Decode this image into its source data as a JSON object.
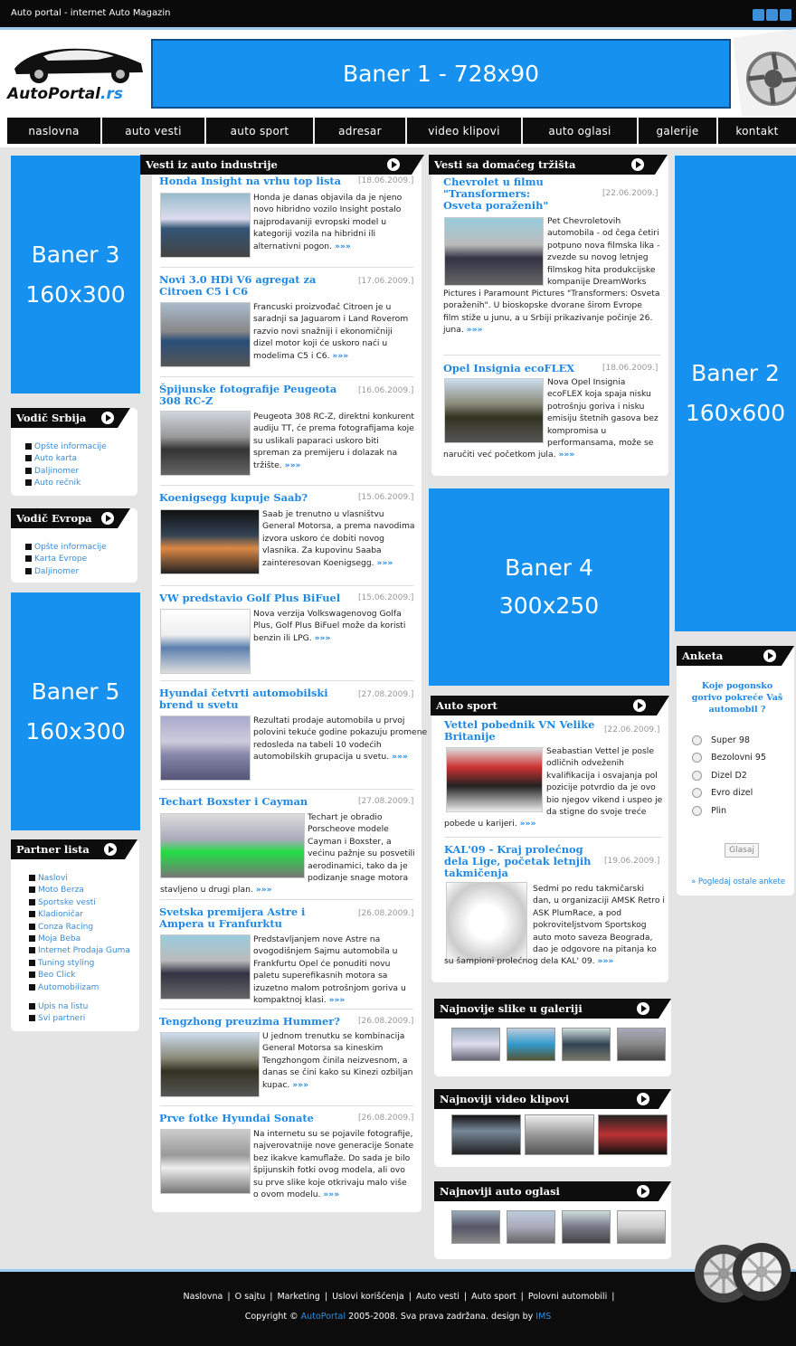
{
  "site": {
    "title": "Auto portal - internet Auto Magazin",
    "logo_main": "AutoPortal",
    "logo_tld": ".rs"
  },
  "banners": {
    "b1": "Baner 1 - 728x90",
    "b2_line1": "Baner 2",
    "b2_line2": "160x600",
    "b3_line1": "Baner 3",
    "b3_line2": "160x300",
    "b4_line1": "Baner 4",
    "b4_line2": "300x250",
    "b5_line1": "Baner 5",
    "b5_line2": "160x300"
  },
  "nav": [
    "naslovna",
    "auto vesti",
    "auto sport",
    "adresar",
    "video klipovi",
    "auto oglasi",
    "galerije",
    "kontakt"
  ],
  "vodic_srbija": {
    "title": "Vodič Srbija",
    "items": [
      "Opšte informacije",
      "Auto karta",
      "Daljinomer",
      "Auto rečnik"
    ]
  },
  "vodic_evropa": {
    "title": "Vodič Evropa",
    "items": [
      "Opšte informacije",
      "Karta Evrope",
      "Daljinomer"
    ]
  },
  "partner_lista": {
    "title": "Partner lista",
    "items": [
      "Naslovi",
      "Moto Berza",
      "Sportske vesti",
      "Kladioničar",
      "Conza Racing",
      "Moja Beba",
      "Internet Prodaja Guma",
      "Tuning styling",
      "Beo Click",
      "Automobilizam"
    ],
    "extra": [
      "Upis na listu",
      "Svi partneri"
    ]
  },
  "industry": {
    "title": "Vesti iz auto industrije",
    "articles": [
      {
        "title": "Honda Insight na vrhu top lista",
        "date": "[18.06.2009.]",
        "text": "Honda je danas objavila da je njeno novo hibridno vozilo Insight postalo najprodavaniji evropski model u kategoriji vozila na hibridni ili alternativni pogon."
      },
      {
        "title": "Novi 3.0 HDi V6 agregat za Citroen C5 i C6",
        "date": "[17.06.2009.]",
        "text": "Francuski proizvođač Citroen je u saradnji sa Jaguarom i Land Roverom razvio novi snažniji i ekonomičniji dizel motor koji će uskoro naći u modelima C5 i C6."
      },
      {
        "title": "Špijunske fotografije Peugeota 308 RC-Z",
        "date": "[16.06.2009.]",
        "text": "Peugeota 308 RC-Z, direktni konkurent audiju TT, će prema fotografijama koje su uslikali paparaci uskoro biti spreman za premijeru i dolazak na tržište."
      },
      {
        "title": "Koenigsegg kupuje Saab?",
        "date": "[15.06.2009.]",
        "text": "Saab je trenutno u vlasništvu General Motorsa, a prema navodima izvora uskoro će dobiti novog vlasnika. Za kupovinu Saaba zainteresovan Koenigsegg."
      },
      {
        "title": "VW predstavio Golf Plus BiFuel",
        "date": "[15.06.2009.]",
        "text": "Nova verzija Volkswagenovog Golfa Plus, Golf Plus BiFuel može da koristi benzin ili LPG."
      },
      {
        "title": "Hyundai četvrti automobilski brend u svetu",
        "date": "[27.08.2009.]",
        "text": "Rezultati prodaje automobila u prvoj polovini tekuće godine pokazuju promene redosleda na tabeli 10 vodećih automobilskih grupacija u svetu."
      },
      {
        "title": "Techart Boxster i Cayman",
        "date": "[27.08.2009.]",
        "text_a": "Techart je obradio Porscheove modele Cayman i Boxster, a većinu pažnje su posvetili aerodinamici, tako da je podizanje snage motora",
        "text_b": "stavljeno u drugi plan."
      },
      {
        "title": "Svetska premijera Astre i Ampera u Franfurktu",
        "date": "[26.08.2009.]",
        "text": "Predstavljanjem nove Astre na ovogodišnjem Sajmu automobila u Frankfurtu Opel će ponuditi novu paletu superefikasnih motora sa izuzetno malom potrošnjom goriva u kompaktnoj klasi."
      },
      {
        "title": "Tengzhong preuzima Hummer?",
        "date": "[26.08.2009.]",
        "text": "U jednom trenutku se kombinacija General Motorsa sa kineskim Tengzhongom činila neizvesnom, a danas se čini kako su Kinezi ozbiljan kupac."
      },
      {
        "title": "Prve fotke Hyundai Sonate",
        "date": "[26.08.2009.]",
        "text": "Na internetu su se pojavile fotografije, najverovatnije nove generacije Sonate bez ikakve kamuflaže. Do sada je bilo špijunskih fotki ovog modela, ali ovo su prve slike koje otkrivaju malo više o ovom modelu."
      }
    ]
  },
  "domestic": {
    "title": "Vesti sa domaćeg tržišta",
    "articles": [
      {
        "title": "Chevrolet u filmu \"Transformers: Osveta poraženih\"",
        "date": "[22.06.2009.]",
        "text_a": "Pet Chevroletovih automobila - od čega četiri potpuno nova filmska lika - zvezde su novog letnjeg filmskog hita produkcijske kompanije DreamWorks",
        "text_b": "Pictures i Paramount Pictures \"Transformers: Osveta poraženih\". U bioskopske dvorane širom Evrope film stiže u junu, a u Srbiji prikazivanje počinje 26. juna."
      },
      {
        "title": "Opel Insignia ecoFLEX",
        "date": "[18.06.2009.]",
        "text_a": "Nova Opel Insignia ecoFLEX koja spaja nisku potrošnju goriva i nisku emisiju štetnih gasova bez kompromisa u performansama, može se",
        "text_b": "naručiti već početkom jula."
      }
    ]
  },
  "autosport": {
    "title": "Auto sport",
    "articles": [
      {
        "title": "Vettel pobednik VN Velike Britanije",
        "date": "[22.06.2009.]",
        "text_a": "Seabastian Vettel je posle odličnih odveženih kvalifikacija i osvajanja pol pozicije potvrdio da je ovo bio njegov vikend i uspeo je da stigne do svoje treće",
        "text_b": "pobede u karijeri."
      },
      {
        "title": "KAL'09 - Kraj prolećnog dela Lige, početak letnjih takmičenja",
        "date": "[19.06.2009.]",
        "text_a": "Sedmi po redu takmičarski dan, u organizaciji AMSK Retro i ASK PlumRace, a pod pokroviteljstvom Sportskog auto moto saveza Beograda, dao je odgovore na pitanja ko",
        "text_b": "su šampioni prolećnog dela KAL' 09."
      }
    ]
  },
  "gallery": {
    "title": "Najnovije slike u galeriji"
  },
  "videos": {
    "title": "Najnoviji video klipovi"
  },
  "ads": {
    "title": "Najnoviji auto oglasi"
  },
  "poll": {
    "title": "Anketa",
    "question": "Koje pogonsko gorivo pokreće Vaš automobil ?",
    "options": [
      "Super 98",
      "Bezolovni 95",
      "Dizel D2",
      "Evro dizel",
      "Plin"
    ],
    "vote": "Glasaj",
    "others": "» Pogledaj ostale ankete"
  },
  "footer": {
    "links": [
      "Naslovna",
      "O sajtu",
      "Marketing",
      "Uslovi korišćenja",
      "Auto vesti",
      "Auto sport",
      "Polovni automobili"
    ],
    "copyright_pre": "Copyright ©",
    "brand": "AutoPortal",
    "copyright_mid": "2005-2008. Sva prava zadržana. design by",
    "designer": "IMS"
  },
  "more_link": "»»»",
  "colors": {
    "accent": "#1e88e5",
    "banner": "#1791ef",
    "bar": "#0d0d0d"
  }
}
